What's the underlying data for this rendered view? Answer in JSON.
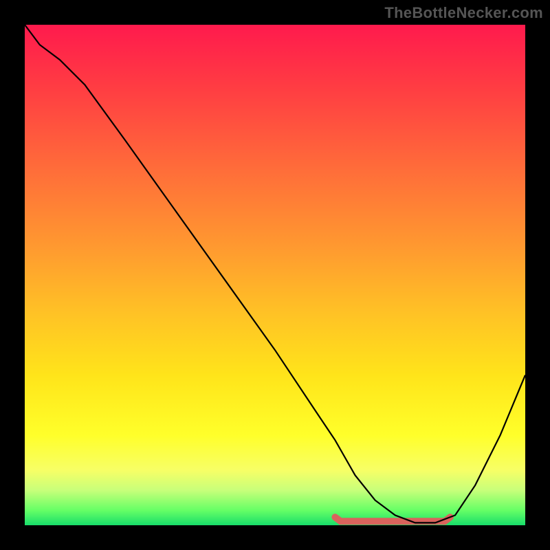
{
  "watermark": "TheBottleNecker.com",
  "chart_data": {
    "type": "line",
    "title": "",
    "xlabel": "",
    "ylabel": "",
    "xlim": [
      0,
      100
    ],
    "ylim": [
      0,
      100
    ],
    "series": [
      {
        "name": "curve",
        "x": [
          0,
          3,
          7,
          12,
          20,
          30,
          40,
          50,
          58,
          62,
          66,
          70,
          74,
          78,
          82,
          86,
          90,
          95,
          100
        ],
        "y": [
          100,
          96,
          93,
          88,
          77,
          63,
          49,
          35,
          23,
          17,
          10,
          5,
          2,
          0.5,
          0.5,
          2,
          8,
          18,
          30
        ]
      }
    ],
    "highlight_band": {
      "x_start": 62,
      "x_end": 85,
      "y": 0.8
    },
    "colors": {
      "curve": "#000000",
      "highlight": "#d9635c",
      "gradient_top": "#ff1a4d",
      "gradient_bottom": "#18dd6a"
    }
  }
}
